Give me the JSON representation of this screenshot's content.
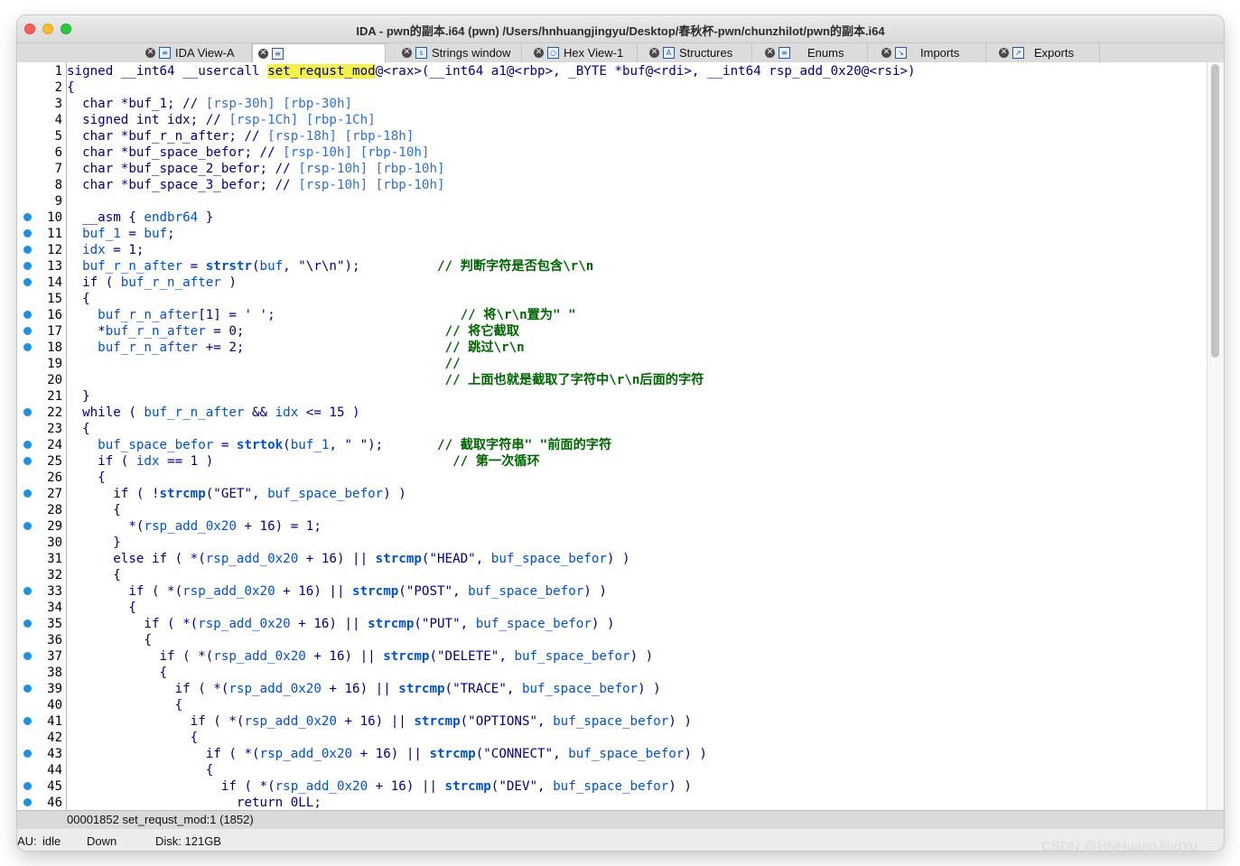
{
  "window": {
    "title": "IDA - pwn的副本.i64 (pwn) /Users/hnhuangjingyu/Desktop/春秋杯-pwn/chunzhilot/pwn的副本.i64"
  },
  "tabs": [
    {
      "label": "IDA View-A",
      "icon": "disassembly-icon"
    },
    {
      "label": "",
      "icon": "pseudocode-icon"
    },
    {
      "label": "Strings window",
      "icon": "strings-icon"
    },
    {
      "label": "Hex View-1",
      "icon": "hex-icon"
    },
    {
      "label": "Structures",
      "icon": "structures-icon"
    },
    {
      "label": "Enums",
      "icon": "enums-icon"
    },
    {
      "label": "Imports",
      "icon": "imports-icon"
    },
    {
      "label": "Exports",
      "icon": "exports-icon"
    }
  ],
  "code": {
    "function_name": "set_requst_mod",
    "lines": [
      {
        "n": "1",
        "dot": false,
        "t": [
          [
            "kw",
            "signed __int64 __usercall "
          ],
          [
            "hl",
            "set_requst_mod"
          ],
          [
            "kw",
            "@<rax>(__int64 a1@<rbp>, _BYTE *buf@<rdi>, __int64 rsp_add_0x20@<rsi>)"
          ]
        ]
      },
      {
        "n": "2",
        "dot": false,
        "t": [
          [
            "kw",
            "{"
          ]
        ]
      },
      {
        "n": "3",
        "dot": false,
        "t": [
          [
            "kw",
            "  char *buf_1; // "
          ],
          [
            "cm",
            "[rsp-30h] [rbp-30h]"
          ]
        ]
      },
      {
        "n": "4",
        "dot": false,
        "t": [
          [
            "kw",
            "  signed int idx; // "
          ],
          [
            "cm",
            "[rsp-1Ch] [rbp-1Ch]"
          ]
        ]
      },
      {
        "n": "5",
        "dot": false,
        "t": [
          [
            "kw",
            "  char *buf_r_n_after; // "
          ],
          [
            "cm",
            "[rsp-18h] [rbp-18h]"
          ]
        ]
      },
      {
        "n": "6",
        "dot": false,
        "t": [
          [
            "kw",
            "  char *buf_space_befor; // "
          ],
          [
            "cm",
            "[rsp-10h] [rbp-10h]"
          ]
        ]
      },
      {
        "n": "7",
        "dot": false,
        "t": [
          [
            "kw",
            "  char *buf_space_2_befor; // "
          ],
          [
            "cm",
            "[rsp-10h] [rbp-10h]"
          ]
        ]
      },
      {
        "n": "8",
        "dot": false,
        "t": [
          [
            "kw",
            "  char *buf_space_3_befor; // "
          ],
          [
            "cm",
            "[rsp-10h] [rbp-10h]"
          ]
        ]
      },
      {
        "n": "9",
        "dot": false,
        "t": []
      },
      {
        "n": "10",
        "dot": true,
        "t": [
          [
            "kw",
            "  __asm { "
          ],
          [
            "var",
            "endbr64"
          ],
          [
            "kw",
            " }"
          ]
        ]
      },
      {
        "n": "11",
        "dot": true,
        "t": [
          [
            "var",
            "  buf_1"
          ],
          [
            "kw",
            " = "
          ],
          [
            "var",
            "buf"
          ],
          [
            "kw",
            ";"
          ]
        ]
      },
      {
        "n": "12",
        "dot": true,
        "t": [
          [
            "var",
            "  idx"
          ],
          [
            "kw",
            " = 1;"
          ]
        ]
      },
      {
        "n": "13",
        "dot": true,
        "t": [
          [
            "var",
            "  buf_r_n_after"
          ],
          [
            "kw",
            " = "
          ],
          [
            "fn",
            "strstr"
          ],
          [
            "kw",
            "("
          ],
          [
            "var",
            "buf"
          ],
          [
            "kw",
            ", \"\\r\\n\");          "
          ],
          [
            "gc",
            "// 判断字符是否包含\\r\\n"
          ]
        ]
      },
      {
        "n": "14",
        "dot": true,
        "t": [
          [
            "kw",
            "  if ( "
          ],
          [
            "var",
            "buf_r_n_after"
          ],
          [
            "kw",
            " )"
          ]
        ]
      },
      {
        "n": "15",
        "dot": false,
        "t": [
          [
            "kw",
            "  {"
          ]
        ]
      },
      {
        "n": "16",
        "dot": true,
        "t": [
          [
            "var",
            "    buf_r_n_after"
          ],
          [
            "kw",
            "[1] = ' ';                        "
          ],
          [
            "gc",
            "// 将\\r\\n置为\" \""
          ]
        ]
      },
      {
        "n": "17",
        "dot": true,
        "t": [
          [
            "kw",
            "    *"
          ],
          [
            "var",
            "buf_r_n_after"
          ],
          [
            "kw",
            " = 0;                          "
          ],
          [
            "gc",
            "// 将它截取"
          ]
        ]
      },
      {
        "n": "18",
        "dot": true,
        "t": [
          [
            "var",
            "    buf_r_n_after"
          ],
          [
            "kw",
            " += 2;                          "
          ],
          [
            "gc",
            "// 跳过\\r\\n"
          ]
        ]
      },
      {
        "n": "19",
        "dot": false,
        "t": [
          [
            "kw",
            "                                                 "
          ],
          [
            "gc",
            "//"
          ]
        ]
      },
      {
        "n": "20",
        "dot": false,
        "t": [
          [
            "kw",
            "                                                 "
          ],
          [
            "gc",
            "// 上面也就是截取了字符中\\r\\n后面的字符"
          ]
        ]
      },
      {
        "n": "21",
        "dot": false,
        "t": [
          [
            "kw",
            "  }"
          ]
        ]
      },
      {
        "n": "22",
        "dot": true,
        "t": [
          [
            "kw",
            "  while ( "
          ],
          [
            "var",
            "buf_r_n_after"
          ],
          [
            "kw",
            " && "
          ],
          [
            "var",
            "idx"
          ],
          [
            "kw",
            " <= 15 )"
          ]
        ]
      },
      {
        "n": "23",
        "dot": false,
        "t": [
          [
            "kw",
            "  {"
          ]
        ]
      },
      {
        "n": "24",
        "dot": true,
        "t": [
          [
            "var",
            "    buf_space_befor"
          ],
          [
            "kw",
            " = "
          ],
          [
            "fn",
            "strtok"
          ],
          [
            "kw",
            "("
          ],
          [
            "var",
            "buf_1"
          ],
          [
            "kw",
            ", \" \");       "
          ],
          [
            "gc",
            "// 截取字符串\" \"前面的字符"
          ]
        ]
      },
      {
        "n": "25",
        "dot": true,
        "t": [
          [
            "kw",
            "    if ( "
          ],
          [
            "var",
            "idx"
          ],
          [
            "kw",
            " == 1 )                               "
          ],
          [
            "gc",
            "// 第一次循环"
          ]
        ]
      },
      {
        "n": "26",
        "dot": false,
        "t": [
          [
            "kw",
            "    {"
          ]
        ]
      },
      {
        "n": "27",
        "dot": true,
        "t": [
          [
            "kw",
            "      if ( !"
          ],
          [
            "fn",
            "strcmp"
          ],
          [
            "kw",
            "(\"GET\", "
          ],
          [
            "var",
            "buf_space_befor"
          ],
          [
            "kw",
            ") )"
          ]
        ]
      },
      {
        "n": "28",
        "dot": false,
        "t": [
          [
            "kw",
            "      {"
          ]
        ]
      },
      {
        "n": "29",
        "dot": true,
        "t": [
          [
            "kw",
            "        *("
          ],
          [
            "var",
            "rsp_add_0x20"
          ],
          [
            "kw",
            " + 16) = 1;"
          ]
        ]
      },
      {
        "n": "30",
        "dot": false,
        "t": [
          [
            "kw",
            "      }"
          ]
        ]
      },
      {
        "n": "31",
        "dot": false,
        "t": [
          [
            "kw",
            "      else if ( *("
          ],
          [
            "var",
            "rsp_add_0x20"
          ],
          [
            "kw",
            " + 16) || "
          ],
          [
            "fn",
            "strcmp"
          ],
          [
            "kw",
            "(\"HEAD\", "
          ],
          [
            "var",
            "buf_space_befor"
          ],
          [
            "kw",
            ") )"
          ]
        ]
      },
      {
        "n": "32",
        "dot": false,
        "t": [
          [
            "kw",
            "      {"
          ]
        ]
      },
      {
        "n": "33",
        "dot": true,
        "t": [
          [
            "kw",
            "        if ( *("
          ],
          [
            "var",
            "rsp_add_0x20"
          ],
          [
            "kw",
            " + 16) || "
          ],
          [
            "fn",
            "strcmp"
          ],
          [
            "kw",
            "(\"POST\", "
          ],
          [
            "var",
            "buf_space_befor"
          ],
          [
            "kw",
            ") )"
          ]
        ]
      },
      {
        "n": "34",
        "dot": false,
        "t": [
          [
            "kw",
            "        {"
          ]
        ]
      },
      {
        "n": "35",
        "dot": true,
        "t": [
          [
            "kw",
            "          if ( *("
          ],
          [
            "var",
            "rsp_add_0x20"
          ],
          [
            "kw",
            " + 16) || "
          ],
          [
            "fn",
            "strcmp"
          ],
          [
            "kw",
            "(\"PUT\", "
          ],
          [
            "var",
            "buf_space_befor"
          ],
          [
            "kw",
            ") )"
          ]
        ]
      },
      {
        "n": "36",
        "dot": false,
        "t": [
          [
            "kw",
            "          {"
          ]
        ]
      },
      {
        "n": "37",
        "dot": true,
        "t": [
          [
            "kw",
            "            if ( *("
          ],
          [
            "var",
            "rsp_add_0x20"
          ],
          [
            "kw",
            " + 16) || "
          ],
          [
            "fn",
            "strcmp"
          ],
          [
            "kw",
            "(\"DELETE\", "
          ],
          [
            "var",
            "buf_space_befor"
          ],
          [
            "kw",
            ") )"
          ]
        ]
      },
      {
        "n": "38",
        "dot": false,
        "t": [
          [
            "kw",
            "            {"
          ]
        ]
      },
      {
        "n": "39",
        "dot": true,
        "t": [
          [
            "kw",
            "              if ( *("
          ],
          [
            "var",
            "rsp_add_0x20"
          ],
          [
            "kw",
            " + 16) || "
          ],
          [
            "fn",
            "strcmp"
          ],
          [
            "kw",
            "(\"TRACE\", "
          ],
          [
            "var",
            "buf_space_befor"
          ],
          [
            "kw",
            ") )"
          ]
        ]
      },
      {
        "n": "40",
        "dot": false,
        "t": [
          [
            "kw",
            "              {"
          ]
        ]
      },
      {
        "n": "41",
        "dot": true,
        "t": [
          [
            "kw",
            "                if ( *("
          ],
          [
            "var",
            "rsp_add_0x20"
          ],
          [
            "kw",
            " + 16) || "
          ],
          [
            "fn",
            "strcmp"
          ],
          [
            "kw",
            "(\"OPTIONS\", "
          ],
          [
            "var",
            "buf_space_befor"
          ],
          [
            "kw",
            ") )"
          ]
        ]
      },
      {
        "n": "42",
        "dot": false,
        "t": [
          [
            "kw",
            "                {"
          ]
        ]
      },
      {
        "n": "43",
        "dot": true,
        "t": [
          [
            "kw",
            "                  if ( *("
          ],
          [
            "var",
            "rsp_add_0x20"
          ],
          [
            "kw",
            " + 16) || "
          ],
          [
            "fn",
            "strcmp"
          ],
          [
            "kw",
            "(\"CONNECT\", "
          ],
          [
            "var",
            "buf_space_befor"
          ],
          [
            "kw",
            ") )"
          ]
        ]
      },
      {
        "n": "44",
        "dot": false,
        "t": [
          [
            "kw",
            "                  {"
          ]
        ]
      },
      {
        "n": "45",
        "dot": true,
        "t": [
          [
            "kw",
            "                    if ( *("
          ],
          [
            "var",
            "rsp_add_0x20"
          ],
          [
            "kw",
            " + 16) || "
          ],
          [
            "fn",
            "strcmp"
          ],
          [
            "kw",
            "(\"DEV\", "
          ],
          [
            "var",
            "buf_space_befor"
          ],
          [
            "kw",
            ") )"
          ]
        ]
      },
      {
        "n": "46",
        "dot": true,
        "t": [
          [
            "kw",
            "                      return 0LL;"
          ]
        ]
      }
    ]
  },
  "status_line": "00001852 set_requst_mod:1 (1852)",
  "bottom": {
    "au": "AU:",
    "au_state": "idle",
    "direction": "Down",
    "disk": "Disk: 121GB"
  },
  "watermark": "CSDN @HNHuangJingYu",
  "colors": {
    "highlight": "#f5f04a",
    "dot": "#1e90e0",
    "comment_green": "#006400",
    "identifier_blue": "#0050d0"
  }
}
